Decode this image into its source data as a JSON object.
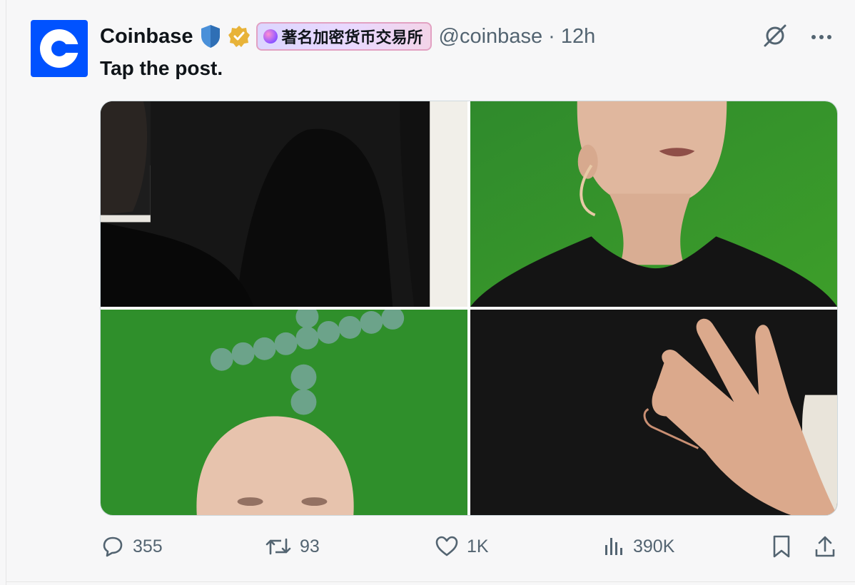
{
  "author": {
    "name": "Coinbase",
    "affiliation": "著名加密货币交易所",
    "handle": "@coinbase",
    "time": "12h",
    "avatar_icon": "coinbase-logo-icon",
    "brand_color": "#0052ff"
  },
  "header_separator": "·",
  "post": {
    "text": "Tap the post."
  },
  "media": {
    "tiles": [
      {
        "name": "photo-top-left"
      },
      {
        "name": "photo-top-right"
      },
      {
        "name": "photo-bottom-left"
      },
      {
        "name": "photo-bottom-right"
      }
    ]
  },
  "actions": {
    "replies": "355",
    "reposts": "93",
    "likes": "1K",
    "views": "390K"
  },
  "icons": {
    "shield": "shield-icon",
    "verified": "verified-badge-icon",
    "grok": "grok-icon",
    "more": "more-icon",
    "reply": "reply-icon",
    "repost": "repost-icon",
    "like": "heart-icon",
    "views": "views-icon",
    "bookmark": "bookmark-icon",
    "share": "share-icon"
  }
}
